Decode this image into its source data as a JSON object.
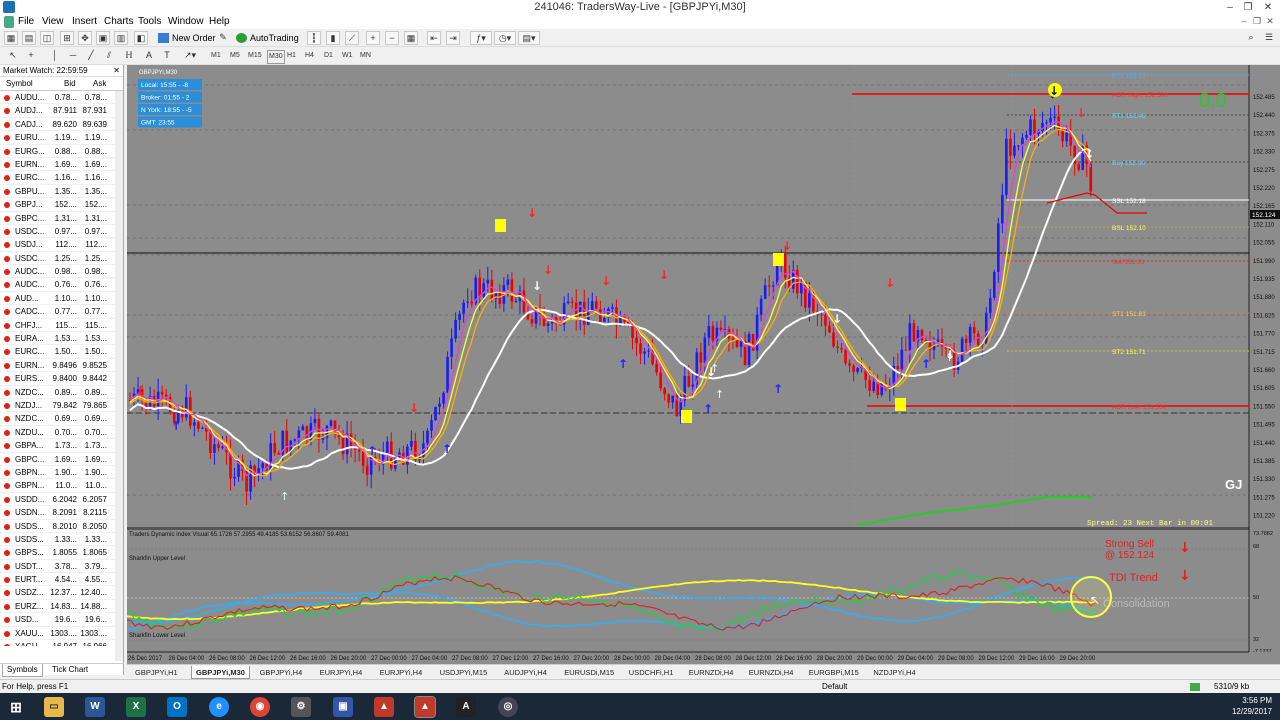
{
  "window": {
    "title": "241046: TradersWay-Live - [GBPJPYi,M30]"
  },
  "menu": [
    "File",
    "View",
    "Insert",
    "Charts",
    "Tools",
    "Window",
    "Help"
  ],
  "toolbar": {
    "new_order": "New Order",
    "autotrading": "AutoTrading",
    "timeframes": [
      "M1",
      "M5",
      "M15",
      "M30",
      "H1",
      "H4",
      "D1",
      "W1",
      "MN"
    ]
  },
  "market_watch": {
    "title": "Market Watch: 22:59:59",
    "columns": [
      "Symbol",
      "Bid",
      "Ask"
    ],
    "rows": [
      {
        "sym": "AUDU...",
        "bid": "0.78...",
        "ask": "0.78..."
      },
      {
        "sym": "AUDJ...",
        "bid": "87.911",
        "ask": "87.931"
      },
      {
        "sym": "CADJ...",
        "bid": "89.620",
        "ask": "89.639"
      },
      {
        "sym": "EURU...",
        "bid": "1.19...",
        "ask": "1.19..."
      },
      {
        "sym": "EURG...",
        "bid": "0.88...",
        "ask": "0.88..."
      },
      {
        "sym": "EURN...",
        "bid": "1.69...",
        "ask": "1.69..."
      },
      {
        "sym": "EURC...",
        "bid": "1.16...",
        "ask": "1.16..."
      },
      {
        "sym": "GBPU...",
        "bid": "1.35...",
        "ask": "1.35..."
      },
      {
        "sym": "GBPJ...",
        "bid": "152....",
        "ask": "152...."
      },
      {
        "sym": "GBPC...",
        "bid": "1.31...",
        "ask": "1.31..."
      },
      {
        "sym": "USDC...",
        "bid": "0.97...",
        "ask": "0.97..."
      },
      {
        "sym": "USDJ...",
        "bid": "112....",
        "ask": "112...."
      },
      {
        "sym": "USDC...",
        "bid": "1.25...",
        "ask": "1.25..."
      },
      {
        "sym": "AUDC...",
        "bid": "0.98...",
        "ask": "0.98..."
      },
      {
        "sym": "AUDC...",
        "bid": "0.76...",
        "ask": "0.76..."
      },
      {
        "sym": "AUD...",
        "bid": "1.10...",
        "ask": "1.10..."
      },
      {
        "sym": "CADC...",
        "bid": "0.77...",
        "ask": "0.77..."
      },
      {
        "sym": "CHFJ...",
        "bid": "115....",
        "ask": "115...."
      },
      {
        "sym": "EURA...",
        "bid": "1.53...",
        "ask": "1.53..."
      },
      {
        "sym": "EURC...",
        "bid": "1.50...",
        "ask": "1.50..."
      },
      {
        "sym": "EURN...",
        "bid": "9.8496",
        "ask": "9.8525"
      },
      {
        "sym": "EURS...",
        "bid": "9.8400",
        "ask": "9.8442"
      },
      {
        "sym": "NZDC...",
        "bid": "0.89...",
        "ask": "0.89..."
      },
      {
        "sym": "NZDJ...",
        "bid": "79.842",
        "ask": "79.865"
      },
      {
        "sym": "NZDC...",
        "bid": "0.69...",
        "ask": "0.69..."
      },
      {
        "sym": "NZDU...",
        "bid": "0.70...",
        "ask": "0.70..."
      },
      {
        "sym": "GBPA...",
        "bid": "1.73...",
        "ask": "1.73..."
      },
      {
        "sym": "GBPC...",
        "bid": "1.69...",
        "ask": "1.69..."
      },
      {
        "sym": "GBPN...",
        "bid": "1.90...",
        "ask": "1.90..."
      },
      {
        "sym": "GBPN...",
        "bid": "11.0...",
        "ask": "11.0..."
      },
      {
        "sym": "USDD...",
        "bid": "6.2042",
        "ask": "6.2057"
      },
      {
        "sym": "USDN...",
        "bid": "8.2091",
        "ask": "8.2115"
      },
      {
        "sym": "USDS...",
        "bid": "8.2010",
        "ask": "8.2050"
      },
      {
        "sym": "USDS...",
        "bid": "1.33...",
        "ask": "1.33..."
      },
      {
        "sym": "GBPS...",
        "bid": "1.8055",
        "ask": "1.8065"
      },
      {
        "sym": "USDT...",
        "bid": "3.78...",
        "ask": "3.79..."
      },
      {
        "sym": "EURT...",
        "bid": "4.54...",
        "ask": "4.55..."
      },
      {
        "sym": "USDZ...",
        "bid": "12.37...",
        "ask": "12.40..."
      },
      {
        "sym": "EURZ...",
        "bid": "14.83...",
        "ask": "14.88..."
      },
      {
        "sym": "USD...",
        "bid": "19.6...",
        "ask": "19.6..."
      },
      {
        "sym": "XAUU...",
        "bid": "1303....",
        "ask": "1303...."
      },
      {
        "sym": "XAGU...",
        "bid": "16.947",
        "ask": "16.966"
      }
    ],
    "tabs": [
      "Symbols",
      "Tick Chart"
    ]
  },
  "chart": {
    "symbol_label": "GBPJPYi,M30",
    "sessions": [
      "Local: 15:55 - -8",
      "Broker: 01:55 - 2",
      "N York: 18:55 - -5",
      "GMT: 23:55"
    ],
    "levels": [
      {
        "label": "BT2 152.57"
      },
      {
        "label": "ADR High: 152.508"
      },
      {
        "label": "BT1 152.45"
      },
      {
        "label": "Buy 152.30"
      },
      {
        "label": "SSL 152.18"
      },
      {
        "label": "BSL 152.10"
      },
      {
        "label": "Sell 151.99"
      },
      {
        "label": "ST1 151.83"
      },
      {
        "label": "ST2 151.71"
      },
      {
        "label": "ADR Low: 151.530"
      }
    ],
    "zero_label": "0.0",
    "pair_code": "GJ",
    "spread_text": "Spread: 23   Next Bar in 00:01",
    "price_axis": [
      "152.485",
      "152.440",
      "152.375",
      "152.330",
      "152.275",
      "152.220",
      "152.165",
      "152.110",
      "152.055",
      "151.990",
      "151.935",
      "151.880",
      "151.825",
      "151.770",
      "151.715",
      "151.660",
      "151.605",
      "151.550",
      "151.495",
      "151.440",
      "151.385",
      "151.330",
      "151.275",
      "151.220"
    ],
    "current_price": "152.124",
    "indicator_title": "Traders Dynamic Index Visual 65.1726 57.2955 49.4185 53.6152 56.8607 59.4081",
    "sharkfin_upper": "Sharkfin Upper Level",
    "sharkfin_lower": "Sharkfin Lower Level",
    "strong_sell_line1": "Strong Sell",
    "strong_sell_line2": "@ 152.124",
    "tdi_trend": "TDI Trend",
    "consolidation": "Consolidation",
    "indicator_axis": [
      "73.7882",
      "68",
      "50",
      "32",
      "-7.1237"
    ],
    "time_axis": [
      "26 Dec 2017",
      "26 Dec 04:00",
      "26 Dec 08:00",
      "26 Dec 12:00",
      "26 Dec 16:00",
      "26 Dec 20:00",
      "27 Dec 00:00",
      "27 Dec 04:00",
      "27 Dec 08:00",
      "27 Dec 12:00",
      "27 Dec 16:00",
      "27 Dec 20:00",
      "28 Dec 00:00",
      "28 Dec 04:00",
      "28 Dec 08:00",
      "28 Dec 12:00",
      "28 Dec 16:00",
      "28 Dec 20:00",
      "29 Dec 00:00",
      "29 Dec 04:00",
      "29 Dec 08:00",
      "29 Dec 12:00",
      "29 Dec 16:00",
      "29 Dec 20:00"
    ]
  },
  "chart_tabs": [
    "GBPJPYi,H1",
    "GBPJPYi,M30",
    "GBPJPYi,H4",
    "EURJPYi,H4",
    "EURJPYi,H4",
    "USDJPYi,M15",
    "AUDJPYi,H4",
    "EURUSDi,M15",
    "USDCHFi,H1",
    "EURNZDi,H4",
    "EURNZDi,H4",
    "EURGBPi,M15",
    "NZDJPYi,H4"
  ],
  "status": {
    "help": "For Help, press F1",
    "profile": "Default",
    "traffic": "5310/9 kb"
  },
  "taskbar": {
    "time": "3:56 PM",
    "date": "12/29/2017"
  }
}
